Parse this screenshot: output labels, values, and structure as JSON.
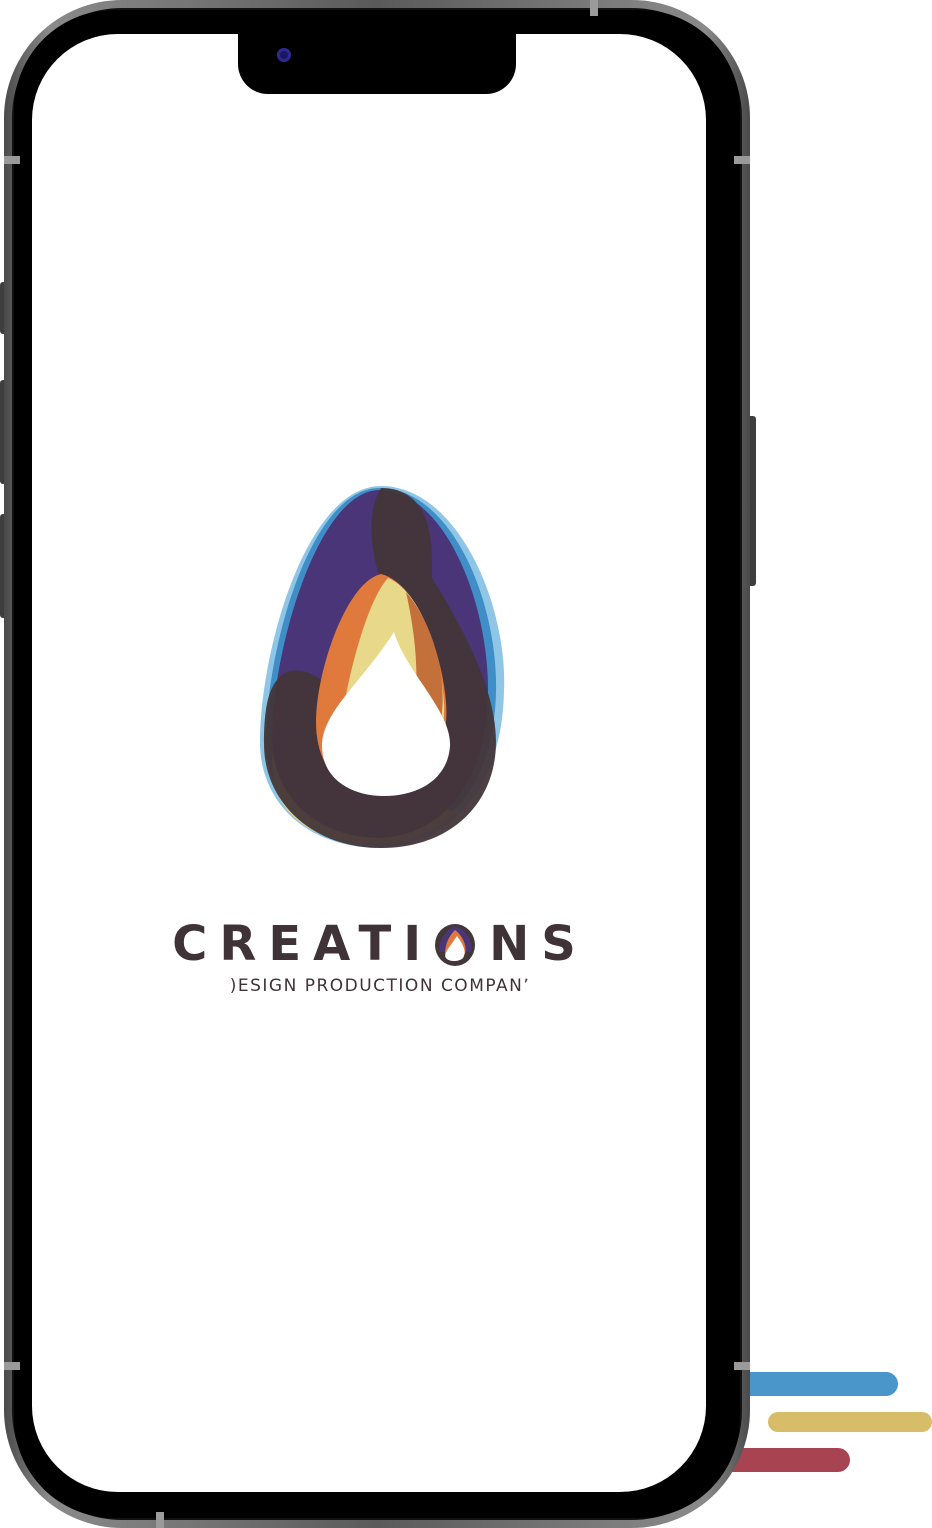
{
  "brand": {
    "name_part1": "CREATI",
    "name_part2": "NS",
    "tagline": ")ESIGN PRODUCTION COMPANʼ"
  },
  "icons": {
    "logo": "creations-drop-logo-icon",
    "camera": "front-camera-icon"
  },
  "colors": {
    "logo_dark": "#433639",
    "logo_purple": "#4a3578",
    "logo_blue": "#3f8ec8",
    "logo_light_blue": "#8fc6e6",
    "logo_orange": "#e07a3c",
    "logo_yellow": "#e8d88a",
    "deco_blue": "#4a95c9",
    "deco_yellow": "#d8bd68",
    "deco_red": "#a84452"
  }
}
